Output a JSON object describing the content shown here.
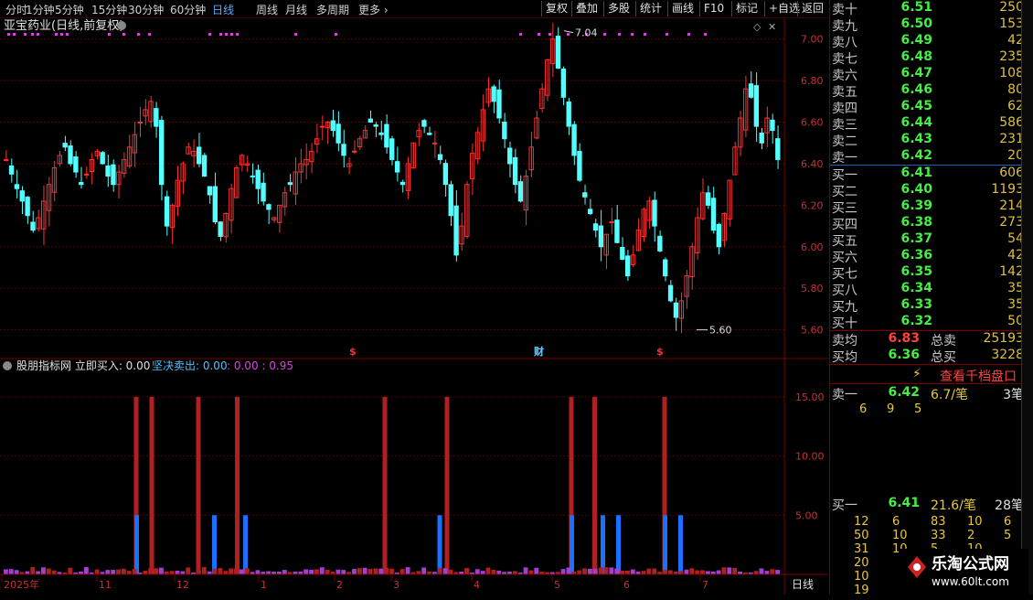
{
  "toolbar": {
    "periods": [
      "分时",
      "1分钟",
      "5分钟",
      "15分钟",
      "30分钟",
      "60分钟",
      "日线",
      "周线",
      "月线",
      "多周期",
      "更多 ›"
    ],
    "active_period": "日线",
    "buttons": [
      "复权",
      "叠加",
      "多股",
      "统计",
      "画线",
      "F10",
      "标记",
      "+自选",
      "返回"
    ]
  },
  "stock_title": "亚宝药业(日线,前复权)",
  "price_axis": [
    "7.00",
    "6.80",
    "6.60",
    "6.40",
    "6.20",
    "6.00",
    "5.80",
    "5.60"
  ],
  "annotations": {
    "high": "7.04",
    "low": "5.60"
  },
  "event_markers": [
    "$",
    "财",
    "$"
  ],
  "indicator": {
    "name": "股朋指标网",
    "line1_label": "立即买入:",
    "line1_value": "0.00",
    "line2_label": "坚决卖出:",
    "line2_value": "0.00",
    "line3_value": "0.00",
    "line4_value": "0.95",
    "axis": [
      "15.00",
      "10.00",
      "5.00"
    ]
  },
  "date_axis": [
    "2025年",
    "11",
    "12",
    "1",
    "2",
    "3",
    "4",
    "5",
    "6",
    "7"
  ],
  "period_label": "日线",
  "orderbook": {
    "asks": [
      {
        "label": "卖十",
        "price": "6.51",
        "vol": "250"
      },
      {
        "label": "卖九",
        "price": "6.50",
        "vol": "153"
      },
      {
        "label": "卖八",
        "price": "6.49",
        "vol": "42"
      },
      {
        "label": "卖七",
        "price": "6.48",
        "vol": "235"
      },
      {
        "label": "卖六",
        "price": "6.47",
        "vol": "108"
      },
      {
        "label": "卖五",
        "price": "6.46",
        "vol": "80"
      },
      {
        "label": "卖四",
        "price": "6.45",
        "vol": "62"
      },
      {
        "label": "卖三",
        "price": "6.44",
        "vol": "586"
      },
      {
        "label": "卖二",
        "price": "6.43",
        "vol": "231"
      },
      {
        "label": "卖一",
        "price": "6.42",
        "vol": "20"
      }
    ],
    "bids": [
      {
        "label": "买一",
        "price": "6.41",
        "vol": "606"
      },
      {
        "label": "买二",
        "price": "6.40",
        "vol": "1193"
      },
      {
        "label": "买三",
        "price": "6.39",
        "vol": "214"
      },
      {
        "label": "买四",
        "price": "6.38",
        "vol": "273"
      },
      {
        "label": "买五",
        "price": "6.37",
        "vol": "54"
      },
      {
        "label": "买六",
        "price": "6.36",
        "vol": "42"
      },
      {
        "label": "买七",
        "price": "6.35",
        "vol": "142"
      },
      {
        "label": "买八",
        "price": "6.34",
        "vol": "35"
      },
      {
        "label": "买九",
        "price": "6.33",
        "vol": "35"
      },
      {
        "label": "买十",
        "price": "6.32",
        "vol": "50"
      }
    ],
    "avg_sell_label": "卖均",
    "avg_sell": "6.83",
    "total_sell_label": "总卖",
    "total_sell": "25193",
    "avg_buy_label": "买均",
    "avg_buy": "6.36",
    "total_buy_label": "总买",
    "total_buy": "3228",
    "view_queue": "查看千档盘口",
    "sell1_label": "卖一",
    "sell1_price": "6.42",
    "sell1_avg": "6.7/笔",
    "sell1_count": "3笔",
    "sell1_queue": [
      "6",
      "9",
      "5"
    ],
    "buy1_label": "买一",
    "buy1_price": "6.41",
    "buy1_avg": "21.6/笔",
    "buy1_count": "28笔",
    "buy1_queue": [
      [
        "12",
        "6",
        "83",
        "10",
        "6"
      ],
      [
        "50",
        "10",
        "33",
        "2",
        "5"
      ],
      [
        "31",
        "10",
        "5",
        "10",
        ""
      ],
      [
        "20",
        "",
        "",
        "",
        ""
      ],
      [
        "10",
        "",
        "",
        "",
        ""
      ],
      [
        "19",
        "",
        "",
        "",
        ""
      ]
    ]
  },
  "watermark": {
    "name": "乐淘公式网",
    "url": "www.60lt.com"
  },
  "colors": {
    "up": "#ff3030",
    "down": "#54ffff",
    "buy_bar": "#b02020",
    "sell_bar": "#1a70ff"
  },
  "chart_data": {
    "type": "candlestick",
    "ylim": [
      5.55,
      7.1
    ],
    "high_annotation": 7.04,
    "low_annotation": 5.6,
    "closes": [
      6.42,
      6.35,
      6.28,
      6.22,
      6.15,
      6.08,
      6.14,
      6.22,
      6.3,
      6.38,
      6.44,
      6.48,
      6.4,
      6.36,
      6.3,
      6.35,
      6.42,
      6.46,
      6.4,
      6.34,
      6.3,
      6.36,
      6.42,
      6.48,
      6.54,
      6.6,
      6.66,
      6.7,
      6.58,
      6.3,
      6.1,
      6.2,
      6.32,
      6.4,
      6.48,
      6.46,
      6.4,
      6.34,
      6.25,
      6.12,
      6.05,
      6.16,
      6.28,
      6.38,
      6.44,
      6.4,
      6.34,
      6.28,
      6.22,
      6.18,
      6.14,
      6.2,
      6.26,
      6.3,
      6.36,
      6.4,
      6.42,
      6.46,
      6.52,
      6.58,
      6.6,
      6.56,
      6.5,
      6.44,
      6.4,
      6.46,
      6.52,
      6.56,
      6.6,
      6.58,
      6.54,
      6.48,
      6.42,
      6.36,
      6.3,
      6.4,
      6.5,
      6.56,
      6.58,
      6.54,
      6.5,
      6.42,
      6.3,
      6.15,
      5.96,
      6.1,
      6.3,
      6.45,
      6.55,
      6.66,
      6.76,
      6.7,
      6.62,
      6.52,
      6.4,
      6.3,
      6.22,
      6.34,
      6.48,
      6.62,
      6.76,
      6.9,
      7.0,
      6.86,
      6.72,
      6.58,
      6.44,
      6.32,
      6.24,
      6.16,
      6.08,
      6.0,
      6.06,
      6.12,
      6.02,
      5.94,
      5.86,
      5.96,
      6.08,
      6.18,
      6.22,
      6.1,
      5.98,
      5.86,
      5.74,
      5.66,
      5.74,
      5.86,
      6.0,
      6.14,
      6.26,
      6.2,
      6.08,
      6.0,
      6.16,
      6.32,
      6.48,
      6.62,
      6.76,
      6.72,
      6.58,
      6.5,
      6.62,
      6.56,
      6.42
    ],
    "indicator_buy_spikes": [
      0.18,
      0.28,
      0.32,
      0.57,
      0.74,
      0.78,
      0.8,
      0.86,
      0.88
    ],
    "indicator_sell_spikes": [
      0.17,
      0.19,
      0.25,
      0.3,
      0.49,
      0.57,
      0.73,
      0.76,
      0.85
    ],
    "indicator_ylim": [
      0,
      17
    ]
  }
}
